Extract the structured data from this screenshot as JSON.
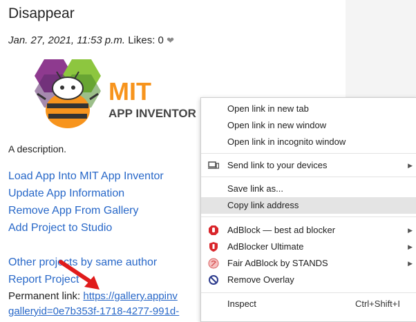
{
  "page": {
    "title": "Disappear",
    "date": "Jan. 27, 2021, 11:53 p.m.",
    "likes": "Likes: 0",
    "logo": {
      "mit": "MIT",
      "app_inventor": "APP INVENTOR"
    },
    "description": "A description.",
    "links": [
      "Load App Into MIT App Inventor",
      "Update App Information",
      "Remove App From Gallery",
      "Add Project to Studio"
    ],
    "links2": [
      "Other projects by same author",
      "Report Project"
    ],
    "permanent_label": "Permanent link:",
    "permanent_url": "https://gallery.appinv",
    "gallery_id": "galleryid=0e7b353f-1718-4277-991d-"
  },
  "context_menu": {
    "items": [
      {
        "label": "Open link in new tab"
      },
      {
        "label": "Open link in new window"
      },
      {
        "label": "Open link in incognito window"
      },
      {
        "label": "Send link to your devices",
        "icon": "devices-icon",
        "submenu": true
      },
      {
        "label": "Save link as..."
      },
      {
        "label": "Copy link address",
        "highlighted": true
      },
      {
        "label": "AdBlock — best ad blocker",
        "icon": "adblock-icon",
        "submenu": true
      },
      {
        "label": "AdBlocker Ultimate",
        "icon": "adblocker-ultimate-icon",
        "submenu": true
      },
      {
        "label": "Fair AdBlock by STANDS",
        "icon": "fair-adblock-icon",
        "submenu": true
      },
      {
        "label": "Remove Overlay",
        "icon": "remove-overlay-icon"
      },
      {
        "label": "Inspect",
        "shortcut": "Ctrl+Shift+I"
      }
    ]
  },
  "colors": {
    "link": "#2767c8",
    "highlight": "#e4e4e4",
    "arrow": "#e01b1b",
    "mit_orange": "#f7941d",
    "hex_purple": "#8e3a8f",
    "hex_green": "#8dc63f"
  }
}
